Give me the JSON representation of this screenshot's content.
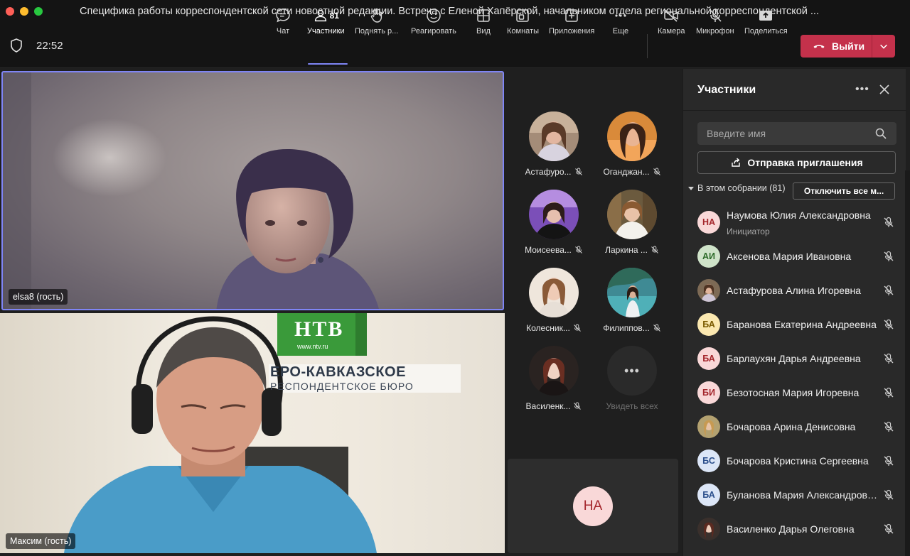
{
  "window": {
    "title": "Специфика работы корреспондентской сети новостной редакции. Встреча с Еленой Хапёрской, начальником отдела региональной корреспондентской ..."
  },
  "toolbar": {
    "time": "22:52",
    "chat": "Чат",
    "participants": "Участники",
    "participants_count": "81",
    "raise_hand": "Поднять р...",
    "react": "Реагировать",
    "view": "Вид",
    "rooms": "Комнаты",
    "apps": "Приложения",
    "more": "Еще",
    "camera": "Камера",
    "mic": "Микрофон",
    "share": "Поделиться",
    "leave": "Выйти"
  },
  "videos": {
    "main_top": "elsa8 (гость)",
    "main_bottom": "Максим (гость)",
    "backdrop_logo": "НТВ",
    "backdrop_url": "www.ntv.ru",
    "backdrop_line1": "ЕРО-КАВКАЗСКОЕ",
    "backdrop_line2": "РЕСПОНДЕНТСКОЕ  БЮРО"
  },
  "gallery": {
    "tiles": [
      {
        "name": "Астафуро..."
      },
      {
        "name": "Оганджан..."
      },
      {
        "name": "Моисеева..."
      },
      {
        "name": "Ларкина ..."
      },
      {
        "name": "Колесник..."
      },
      {
        "name": "Филиппов..."
      },
      {
        "name": "Василенк..."
      }
    ],
    "see_all": "Увидеть всех",
    "self_initials": "НА"
  },
  "panel": {
    "title": "Участники",
    "search_placeholder": "Введите имя",
    "invite": "Отправка приглашения",
    "section": "В этом собрании (81)",
    "mute_all": "Отключить все м...",
    "participants": [
      {
        "initials": "НА",
        "name": "Наумова Юлия Александровна",
        "role": "Инициатор",
        "bg": "#f9d8d8",
        "fg": "#a4262c"
      },
      {
        "initials": "АИ",
        "name": "Аксенова Мария Ивановна",
        "bg": "#cfe3c9",
        "fg": "#2e6b2a"
      },
      {
        "initials": "",
        "name": "Астафурова Алина Игоревна",
        "photo": true
      },
      {
        "initials": "БА",
        "name": "Баранова Екатерина Андреевна",
        "bg": "#fbe8b0",
        "fg": "#7a5a00"
      },
      {
        "initials": "БА",
        "name": "Барлаухян Дарья Андреевна",
        "bg": "#f9d8d8",
        "fg": "#a4262c"
      },
      {
        "initials": "БИ",
        "name": "Безотосная Мария Игоревна",
        "bg": "#f9d8d8",
        "fg": "#a4262c"
      },
      {
        "initials": "",
        "name": "Бочарова Арина Денисовна",
        "photo": true
      },
      {
        "initials": "БС",
        "name": "Бочарова Кристина Сергеевна",
        "bg": "#dce6f7",
        "fg": "#2b4f8c"
      },
      {
        "initials": "БА",
        "name": "Буланова Мария Александровна",
        "bg": "#dce6f7",
        "fg": "#2b4f8c"
      },
      {
        "initials": "",
        "name": "Василенко Дарья Олеговна",
        "photo": true
      }
    ]
  },
  "colors": {
    "accent": "#7f85f5",
    "leave": "#c4314b",
    "panel_bg": "#292929",
    "toolbar_bg": "#141414"
  }
}
